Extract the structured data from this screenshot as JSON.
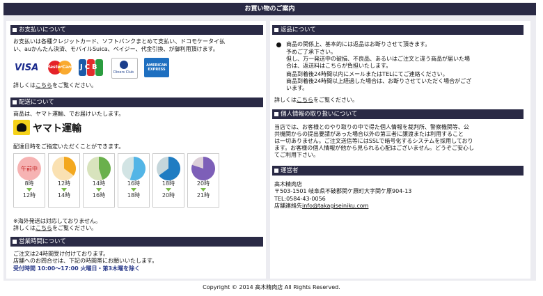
{
  "header": {
    "title": "お買い物のご案内"
  },
  "payment": {
    "heading": "お支払いについて",
    "line1": "お支払いは各種クレジットカード、ソフトバンクまとめて支払い、ドコモケータイ払",
    "line2": "い、auかんたん決済、モバイルSuica、ペイジー、代金引換、が御利用頂けます。",
    "cards": [
      "VISA",
      "MasterCard",
      "JCB",
      "Diners Club",
      "AMERICAN EXPRESS"
    ],
    "details_prefix": "詳しくは",
    "details_link": "こちら",
    "details_suffix": "をご覧ください。"
  },
  "delivery": {
    "heading": "配送について",
    "line1": "商品は、ヤマト運輸、でお届けいたします。",
    "carrier_logo": "ヤマト運輸",
    "line2": "配達日時をご指定いただくことができます。",
    "slots": [
      {
        "from": "午前中",
        "to": "12時",
        "color": "#e84a4a"
      },
      {
        "from": "12時",
        "to": "14時",
        "color": "#f3a81f"
      },
      {
        "from": "14時",
        "to": "16時",
        "color": "#6ab04c"
      },
      {
        "from": "16時",
        "to": "18時",
        "color": "#53b5e6"
      },
      {
        "from": "18時",
        "to": "20時",
        "color": "#1f7cc2"
      },
      {
        "from": "20時",
        "to": "21時",
        "color": "#7d5fb8"
      }
    ],
    "note1": "※海外発送は対応しておりません。",
    "details_prefix": "詳しくは",
    "details_link": "こちら",
    "details_suffix": "をご覧ください。"
  },
  "hours": {
    "heading": "営業時間について",
    "line1": "ご注文は24時間受け付けております。",
    "line2": "店舗へのお問合せは、下記の時間帯にお願いいたします。",
    "hours_line": "受付時間 10:00～17:00 火曜日・第3木曜を除く"
  },
  "returns": {
    "heading": "返品について",
    "l1": "商品の関係上、基本的には返品はお断りさせて頂きます。",
    "l2": "予めご了承下さい。",
    "l3": "但し、万一発送中の破損、不良品、あるいはご注文と違う商品が届いた場",
    "l4": "合は、返送料はこちらが負担いたします。",
    "l5": "商品到着後24時間以内にメールまたはTELにてご連絡ください。",
    "l6": "商品到着後24時間以上経過した場合は、お断りさせていただく場合がござ",
    "l7": "います。",
    "details_prefix": "詳しくは",
    "details_link": "こちら",
    "details_suffix": "をご覧ください。"
  },
  "privacy": {
    "heading": "個人情報の取り扱いについて",
    "l1": "当店では、お客様とのやり取りの中で得た個人情報を裁判所、警察機関等、公",
    "l2": "共機関からの提出要請があった場合以外の第三者に譲渡または利用すること",
    "l3": "は一切ありません。ご注文送信等にはSSLで暗号化するシステムを採用しており",
    "l4": "ます。お客様の個人情報が他から見られる心配はございません。どうぞご安心し",
    "l5": "てご利用下さい。"
  },
  "operator": {
    "heading": "運営者",
    "name": "高木精肉店",
    "address": "〒503-1501 岐阜県不破郡関ケ原町大字関ケ原904-13",
    "tel": "TEL:0584-43-0056",
    "email_prefix": "店舗連絡先",
    "email": "info@takagiseiniku.com"
  },
  "footer": {
    "copyright": "Copyright © 2014 高木精肉店 All Rights Reserved."
  }
}
